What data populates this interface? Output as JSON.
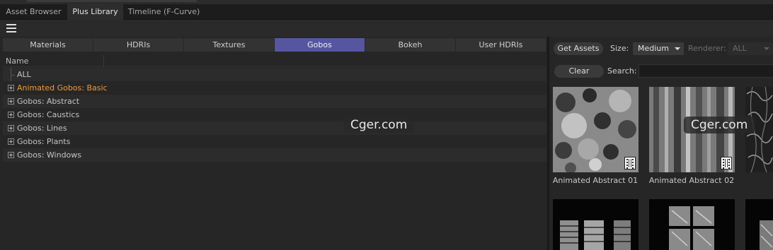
{
  "window_tabs": [
    {
      "label": "Asset Browser",
      "active": false
    },
    {
      "label": "Plus Library",
      "active": true
    },
    {
      "label": "Timeline (F-Curve)",
      "active": false
    }
  ],
  "menu_icon": "hamburger-menu-icon",
  "category_tabs": [
    {
      "label": "Materials",
      "active": false
    },
    {
      "label": "HDRIs",
      "active": false
    },
    {
      "label": "Textures",
      "active": false
    },
    {
      "label": "Gobos",
      "active": true
    },
    {
      "label": "Bokeh",
      "active": false
    },
    {
      "label": "User HDRIs",
      "active": false
    }
  ],
  "tree": {
    "column_header": "Name",
    "items": [
      {
        "label": "ALL",
        "expandable": false,
        "highlight": false
      },
      {
        "label": "Animated Gobos: Basic",
        "expandable": true,
        "highlight": true
      },
      {
        "label": "Gobos: Abstract",
        "expandable": true,
        "highlight": false
      },
      {
        "label": "Gobos: Caustics",
        "expandable": true,
        "highlight": false
      },
      {
        "label": "Gobos: Lines",
        "expandable": true,
        "highlight": false
      },
      {
        "label": "Gobos: Plants",
        "expandable": true,
        "highlight": false
      },
      {
        "label": "Gobos: Windows",
        "expandable": true,
        "highlight": false
      }
    ]
  },
  "right_toolbar": {
    "get_assets_label": "Get Assets",
    "size_label": "Size:",
    "size_value": "Medium",
    "renderer_label": "Renderer:",
    "renderer_value": "ALL",
    "clear_label": "Clear",
    "search_label": "Search:",
    "search_value": ""
  },
  "assets": [
    {
      "name": "Animated Abstract 01",
      "animated": true
    },
    {
      "name": "Animated Abstract 02",
      "animated": true
    },
    {
      "name": "",
      "animated": false
    },
    {
      "name": "",
      "animated": false
    },
    {
      "name": "",
      "animated": false
    },
    {
      "name": "",
      "animated": false
    }
  ],
  "watermark": "Cger.com",
  "colors": {
    "active_tab": "#5656a0",
    "highlight_text": "#ef9a3c",
    "background": "#262626"
  }
}
